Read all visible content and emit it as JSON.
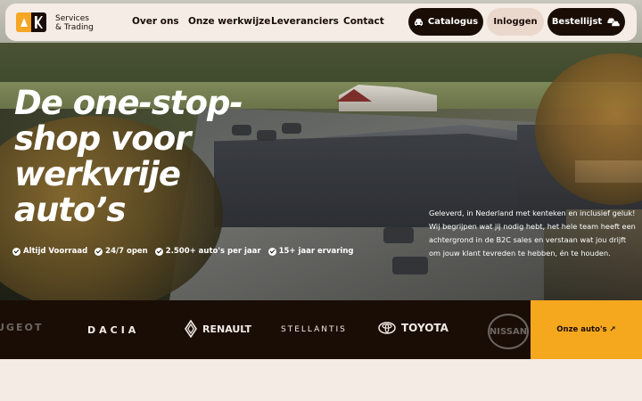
{
  "brand": {
    "logo_letters": "AK",
    "line1": "Services",
    "line2": "& Trading"
  },
  "nav": {
    "links": [
      "Over ons",
      "Onze werkwijze",
      "Leveranciers",
      "Contact"
    ],
    "catalogus": "Catalogus",
    "inloggen": "Inloggen",
    "bestellijst": "Bestellijst"
  },
  "hero": {
    "headline_lines": [
      "De one-stop-",
      "shop voor",
      "werkvrije",
      "auto’s"
    ],
    "usps": [
      "Altijd Voorraad",
      "24/7 open",
      "2.500+ auto's per jaar",
      "15+ jaar ervaring"
    ],
    "intro": "Geleverd, in Nederland met kenteken en inclusief geluk! Wij begrijpen wat jij nodig hebt, het hele team heeft een achtergrond in de B2C sales en verstaan wat jou drijft om jouw klant tevreden te hebben, én te houden.",
    "building_sign": "AK SERVICES & TRADING"
  },
  "brands": {
    "peugeot": "UGEOT",
    "dacia": "DACIA",
    "renault": "RENAULT",
    "stellantis": "STELLANTIS",
    "toyota": "TOYOTA",
    "nissan": "NISSAN"
  },
  "cta": {
    "label": "Onze auto's ↗"
  },
  "colors": {
    "dark": "#1a0d06",
    "accent": "#f5a81e",
    "cream": "#f5ece6"
  },
  "icons": {
    "catalogus": "car-icon",
    "bestellijst": "cars-icon",
    "usp": "check-circle-icon"
  }
}
